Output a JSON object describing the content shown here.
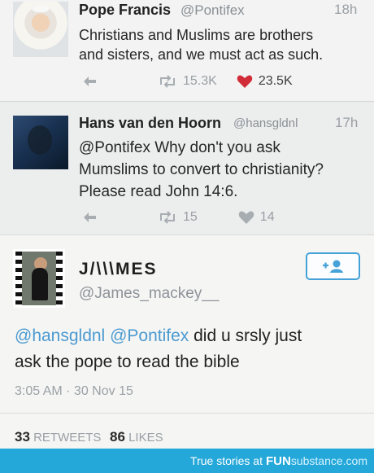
{
  "tweets": [
    {
      "name": "Pope Francis",
      "handle": "@Pontifex",
      "time": "18h",
      "text": [
        "Christians and Muslims are brothers",
        "and sisters, and we must act as such."
      ],
      "retweets": "15.3K",
      "likes": "23.5K"
    },
    {
      "name": "Hans van den Hoorn",
      "handle": "@hansgldnl",
      "time": "17h",
      "text": [
        "@Pontifex Why don't you ask",
        "Mumslims to convert to christianity?",
        "Please read John 14:6."
      ],
      "retweets": "15",
      "likes": "14"
    }
  ],
  "reply": {
    "name": "J/\\\\\\MES",
    "handle": "@James_mackey__",
    "mention1": "@hansgldnl",
    "mention2": "@Pontifex",
    "text_line1": " did u srsly just",
    "text_line2": "ask the pope to read the bible",
    "timestamp": "3:05 AM · 30 Nov 15",
    "retweets_count": "33",
    "retweets_label": "RETWEETS",
    "likes_count": "86",
    "likes_label": "LIKES"
  },
  "footer": {
    "prefix": "True stories at",
    "brand": "FUN",
    "brand_suffix": "substance.com"
  },
  "colors": {
    "accent": "#45a2d8",
    "like_red": "#d12d39",
    "footer_blue": "#24a7d9"
  },
  "icons": [
    "reply-icon",
    "retweet-icon",
    "heart-icon",
    "follow-user-icon"
  ]
}
